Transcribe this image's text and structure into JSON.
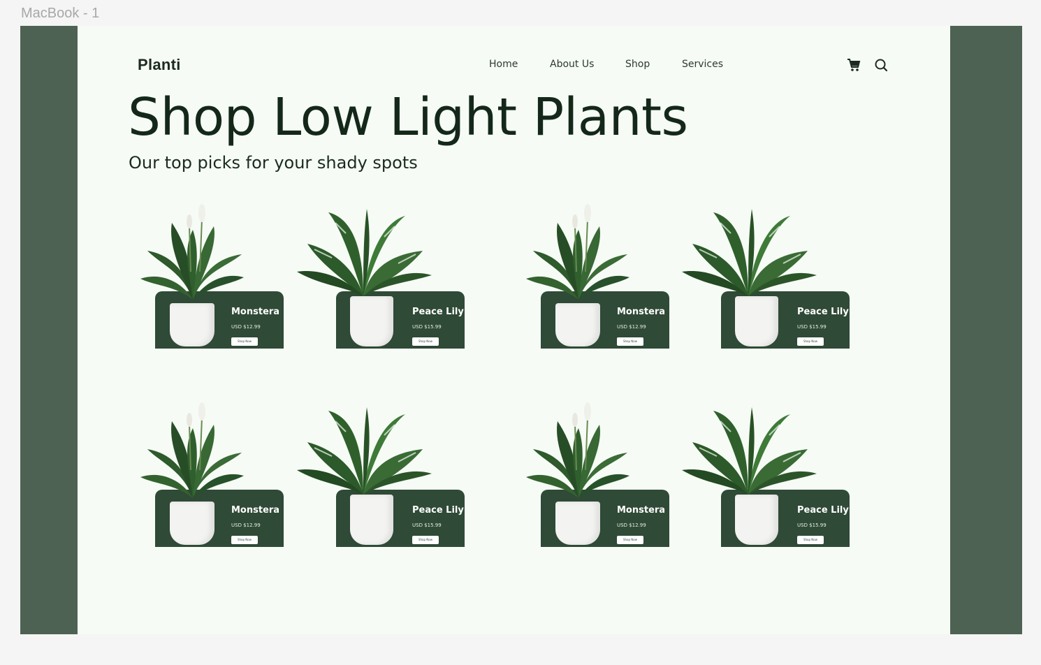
{
  "editor": {
    "frame_label": "MacBook - 1"
  },
  "header": {
    "logo": "Planti",
    "nav": [
      "Home",
      "About Us",
      "Shop",
      "Services"
    ],
    "icons": [
      "cart-icon",
      "search-icon"
    ]
  },
  "hero": {
    "title": "Shop Low Light Plants",
    "subtitle": "Our top picks for your shady spots"
  },
  "products": [
    {
      "name": "Monstera",
      "price": "USD $12.99",
      "button": "Shop Now",
      "plant": "peace-lily-icon"
    },
    {
      "name": "Peace Lily",
      "price": "USD $15.99",
      "button": "Shop Now",
      "plant": "monstera-icon"
    },
    {
      "name": "Monstera",
      "price": "USD $12.99",
      "button": "Shop Now",
      "plant": "peace-lily-icon"
    },
    {
      "name": "Peace Lily",
      "price": "USD $15.99",
      "button": "Shop Now",
      "plant": "monstera-icon"
    },
    {
      "name": "Monstera",
      "price": "USD $12.99",
      "button": "Shop Now",
      "plant": "peace-lily-icon"
    },
    {
      "name": "Peace Lily",
      "price": "USD $15.99",
      "button": "Shop Now",
      "plant": "monstera-icon"
    },
    {
      "name": "Monstera",
      "price": "USD $12.99",
      "button": "Shop Now",
      "plant": "peace-lily-icon"
    },
    {
      "name": "Peace Lily",
      "price": "USD $15.99",
      "button": "Shop Now",
      "plant": "monstera-icon"
    }
  ],
  "colors": {
    "side_panel": "#4e6253",
    "page_bg": "#f6fbf5",
    "card_panel": "#2f4a36",
    "text_dark": "#14281a"
  }
}
